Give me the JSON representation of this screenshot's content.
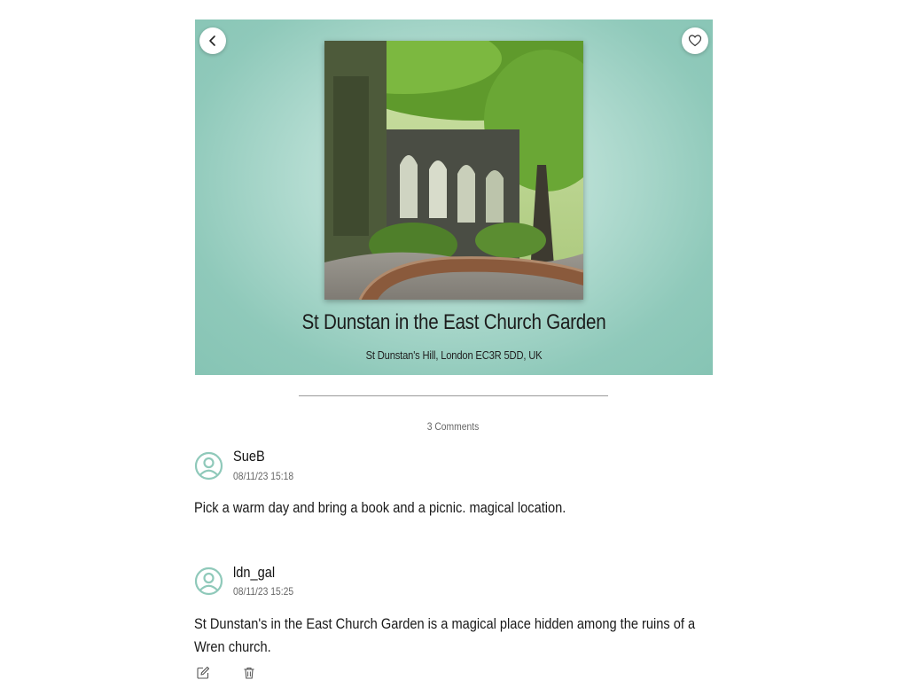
{
  "place": {
    "title": "St Dunstan in the East Church Garden",
    "address": "St Dunstan's Hill, London EC3R 5DD, UK"
  },
  "header": {
    "back_icon": "chevron-left-icon",
    "favorite_icon": "heart-icon"
  },
  "comments_section": {
    "count_label": "3 Comments"
  },
  "comments": [
    {
      "user": "SueB",
      "timestamp": "08/11/23 15:18",
      "text": "Pick a warm day and bring a book and a picnic. magical location."
    },
    {
      "user": "ldn_gal",
      "timestamp": "08/11/23 15:25",
      "text": "St Dunstan's in the East Church Garden is a magical place hidden among the ruins of a Wren church.",
      "actions": {
        "edit_icon": "edit-icon",
        "delete_icon": "trash-icon"
      }
    }
  ],
  "colors": {
    "hero_background": "#9dd1c4",
    "text": "#1a1a1a",
    "muted": "#666666"
  }
}
